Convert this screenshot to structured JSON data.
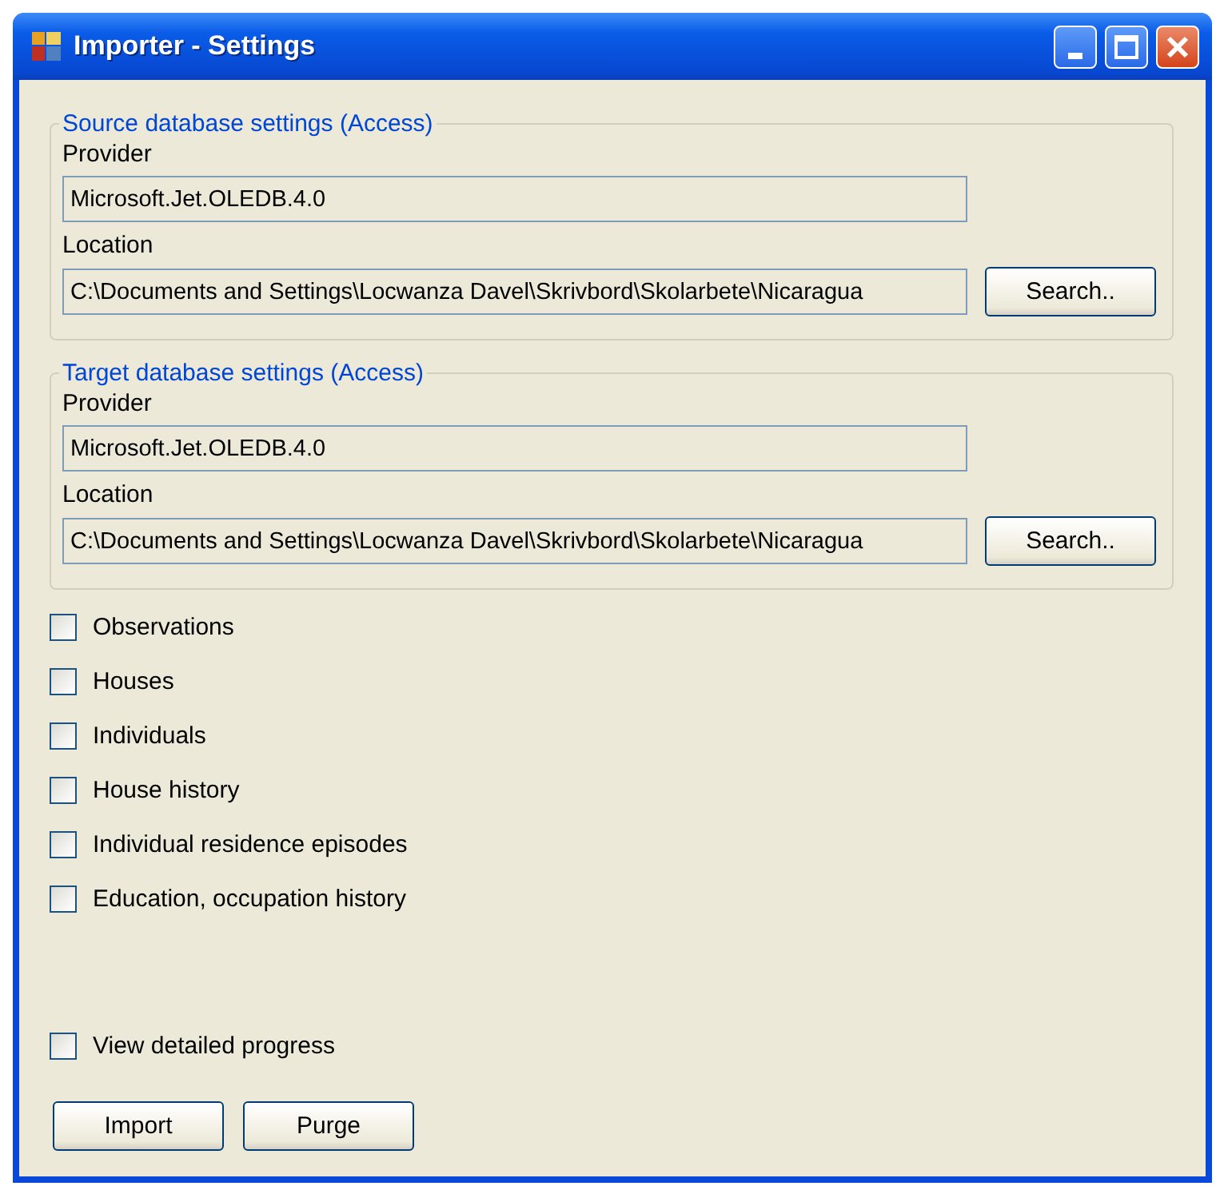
{
  "window": {
    "title": "Importer - Settings"
  },
  "groups": [
    {
      "title": "Source database settings (Access)",
      "provider_label": "Provider",
      "provider": "Microsoft.Jet.OLEDB.4.0",
      "location_label": "Location",
      "location": "C:\\Documents and Settings\\Locwanza Davel\\Skrivbord\\Skolarbete\\Nicaragua",
      "button": "Search.."
    },
    {
      "title": "Target database settings (Access)",
      "provider_label": "Provider",
      "provider": "Microsoft.Jet.OLEDB.4.0",
      "location_label": "Location",
      "location": "C:\\Documents and Settings\\Locwanza Davel\\Skrivbord\\Skolarbete\\Nicaragua",
      "button": "Search.."
    }
  ],
  "options": [
    {
      "label": "Observations",
      "checked": false
    },
    {
      "label": "Houses",
      "checked": false
    },
    {
      "label": "Individuals",
      "checked": false
    },
    {
      "label": "House history",
      "checked": false
    },
    {
      "label": "Individual residence episodes",
      "checked": false
    },
    {
      "label": "Education, occupation history",
      "checked": false
    }
  ],
  "progress_option": {
    "label": "View detailed progress",
    "checked": false
  },
  "buttons": [
    "Import",
    "Purge"
  ]
}
